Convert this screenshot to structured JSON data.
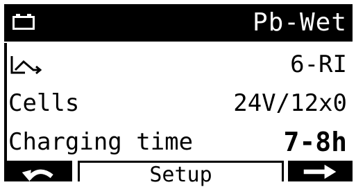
{
  "header": {
    "battery_icon": "battery-icon",
    "chemistry": "Pb-Wet"
  },
  "rows": [
    {
      "icon": "charge-curve-icon",
      "label": "",
      "value": "6-RI"
    },
    {
      "label": "Cells",
      "value": "24V/12x0"
    },
    {
      "label": "Charging time",
      "value": "7-8h"
    }
  ],
  "footer": {
    "left_icon": "back-arrow-icon",
    "middle_label": "Setup",
    "right_icon": "forward-arrow-icon"
  }
}
